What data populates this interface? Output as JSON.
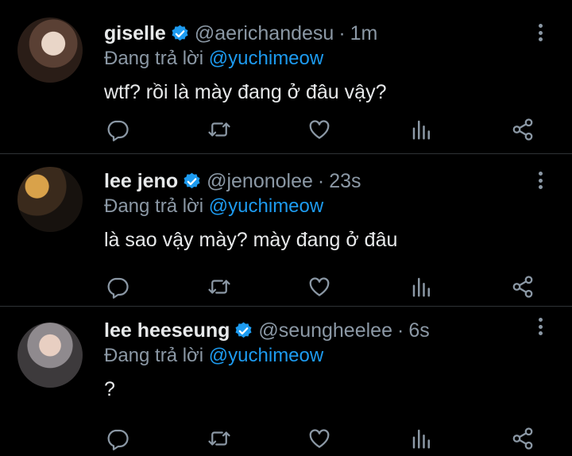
{
  "colors": {
    "background": "#000000",
    "text": "#e7e9ea",
    "muted": "#8b98a5",
    "accent": "#1d9bf0",
    "divider": "#2f3336"
  },
  "tweets": [
    {
      "name": "giselle",
      "handle": "@aerichandesu",
      "separator": "·",
      "time": "1m",
      "reply_prefix": "Đang trả lời",
      "reply_to": "@yuchimeow",
      "text": "wtf? rồi là mày đang ở đâu vậy?",
      "verified": true
    },
    {
      "name": "lee jeno",
      "handle": "@jenonolee",
      "separator": "·",
      "time": "23s",
      "reply_prefix": "Đang trả lời",
      "reply_to": "@yuchimeow",
      "text": "là sao vậy mày? mày đang ở đâu",
      "verified": true
    },
    {
      "name": "lee heeseung",
      "handle": "@seungheelee",
      "separator": "·",
      "time": "6s",
      "reply_prefix": "Đang trả lời",
      "reply_to": "@yuchimeow",
      "text": "?",
      "verified": true
    }
  ],
  "icons": {
    "reply": "comment-icon",
    "retweet": "retweet-icon",
    "like": "heart-icon",
    "stats": "bar-chart-icon",
    "share": "share-icon",
    "more": "more-vertical-icon",
    "verified": "verified-badge-icon"
  }
}
